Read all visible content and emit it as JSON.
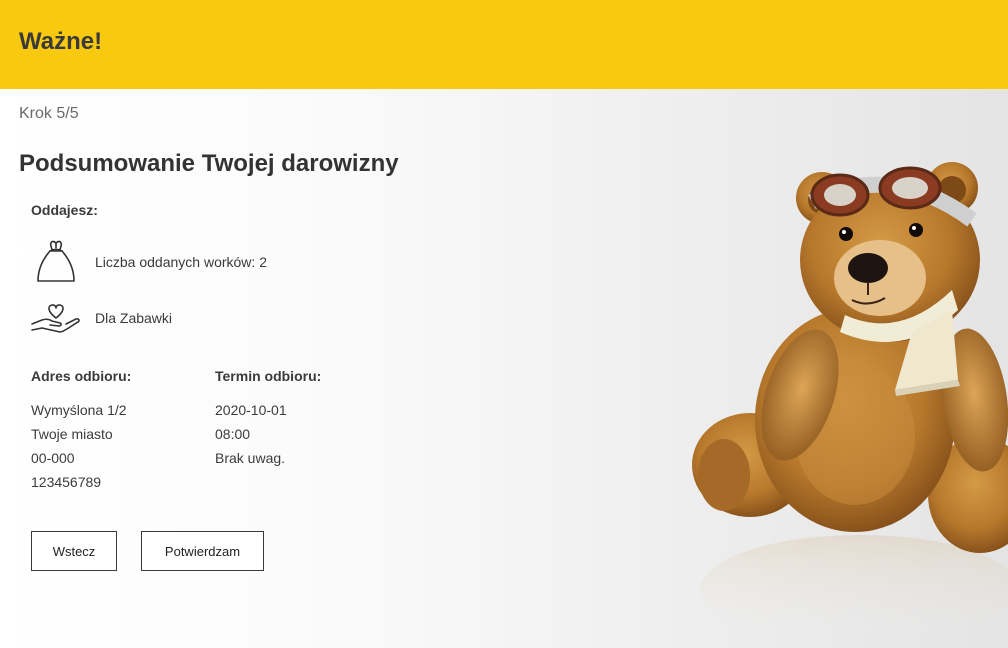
{
  "banner": {
    "title": "Ważne!"
  },
  "step": {
    "label": "Krok 5/5"
  },
  "summary": {
    "title": "Podsumowanie Twojej darowizny",
    "giving_label": "Oddajesz:",
    "items": [
      {
        "icon": "bag-icon",
        "text": "Liczba oddanych worków: 2"
      },
      {
        "icon": "heart-hand-icon",
        "text": "Dla Zabawki"
      }
    ]
  },
  "address": {
    "label": "Adres odbioru:",
    "lines": [
      "Wymyślona 1/2",
      "Twoje miasto",
      "00-000",
      "123456789"
    ]
  },
  "pickup": {
    "label": "Termin odbioru:",
    "lines": [
      "2020-10-01",
      "08:00",
      "Brak uwag."
    ]
  },
  "buttons": {
    "back": "Wstecz",
    "confirm": "Potwierdzam"
  },
  "colors": {
    "accent": "#f8c90f",
    "text": "#3a3a3a"
  }
}
